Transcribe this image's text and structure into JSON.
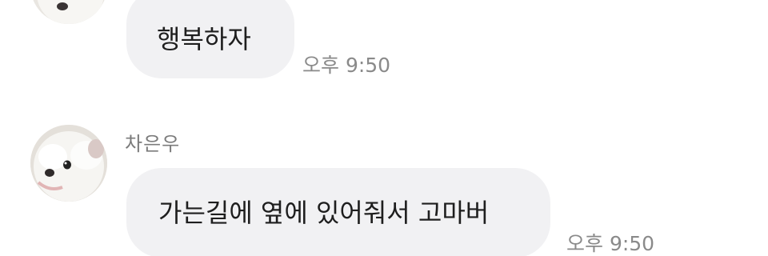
{
  "messages": [
    {
      "text": "행복하자",
      "time": "오후 9:50",
      "avatar_icon": "white-puppy-avatar-icon"
    },
    {
      "sender": "차은우",
      "text": "가는길에 옆에 있어줘서 고마버",
      "time": "오후 9:50",
      "avatar_icon": "white-puppy-avatar-icon"
    }
  ],
  "colors": {
    "bubble": "#f1f1f3",
    "timestamp": "#8a8a8a",
    "sender": "#7b7b7b",
    "background": "#ffffff"
  }
}
